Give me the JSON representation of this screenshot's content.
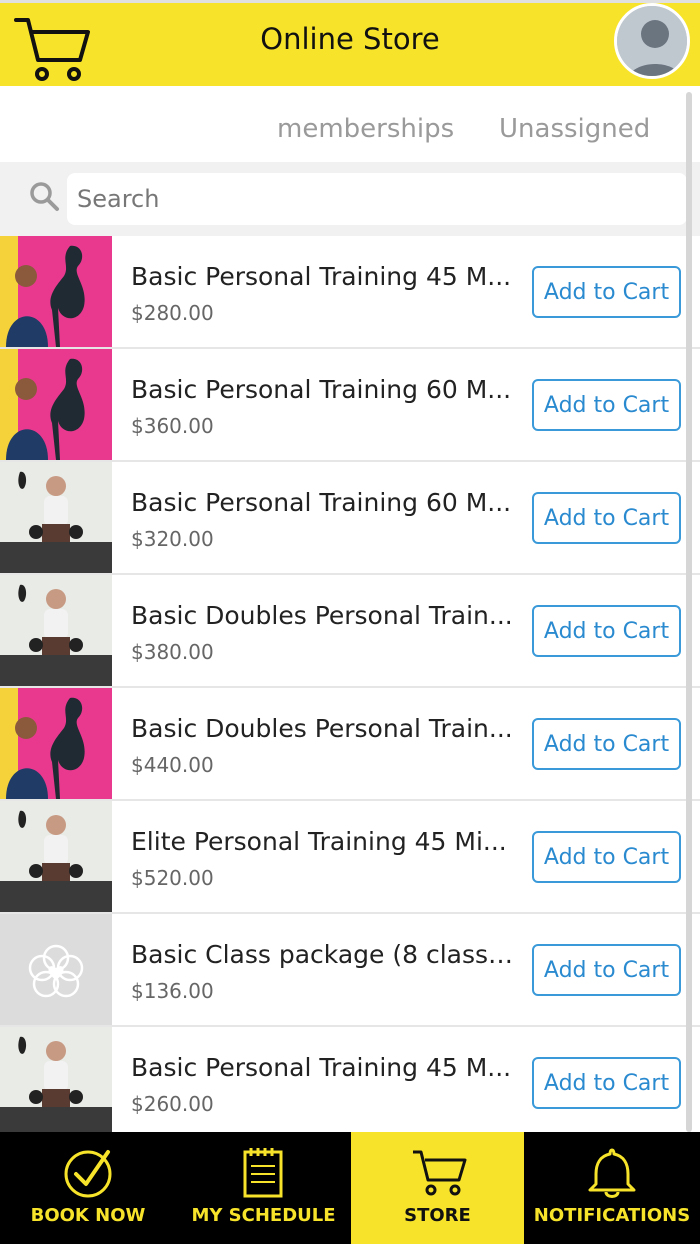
{
  "header": {
    "title": "Online Store"
  },
  "tabs": [
    {
      "label": "memberships"
    },
    {
      "label": "Unassigned"
    }
  ],
  "search": {
    "placeholder": "Search"
  },
  "products": [
    {
      "name": "Basic Personal Training 45 M...",
      "price": "$280.00",
      "button": "Add to Cart",
      "image": "flamingo-photo"
    },
    {
      "name": "Basic Personal Training 60 M...",
      "price": "$360.00",
      "button": "Add to Cart",
      "image": "flamingo-photo"
    },
    {
      "name": "Basic Personal Training 60 M...",
      "price": "$320.00",
      "button": "Add to Cart",
      "image": "gym-photo"
    },
    {
      "name": "Basic Doubles Personal Train...",
      "price": "$380.00",
      "button": "Add to Cart",
      "image": "gym-photo"
    },
    {
      "name": "Basic Doubles Personal Train...",
      "price": "$440.00",
      "button": "Add to Cart",
      "image": "flamingo-photo"
    },
    {
      "name": "Elite Personal Training 45 Mi...",
      "price": "$520.00",
      "button": "Add to Cart",
      "image": "gym-photo"
    },
    {
      "name": "Basic Class package (8 classe...",
      "price": "$136.00",
      "button": "Add to Cart",
      "image": "logo-placeholder"
    },
    {
      "name": "Basic Personal Training 45 M...",
      "price": "$260.00",
      "button": "Add to Cart",
      "image": "gym-photo"
    }
  ],
  "nav": [
    {
      "label": "BOOK NOW",
      "icon": "check-circle-icon"
    },
    {
      "label": "MY SCHEDULE",
      "icon": "calendar-icon"
    },
    {
      "label": "STORE",
      "icon": "cart-icon",
      "active": true
    },
    {
      "label": "NOTIFICATIONS",
      "icon": "bell-icon"
    }
  ],
  "colors": {
    "brand_yellow": "#f7e42a",
    "button_blue": "#3a9ad9",
    "nav_black": "#000000"
  }
}
